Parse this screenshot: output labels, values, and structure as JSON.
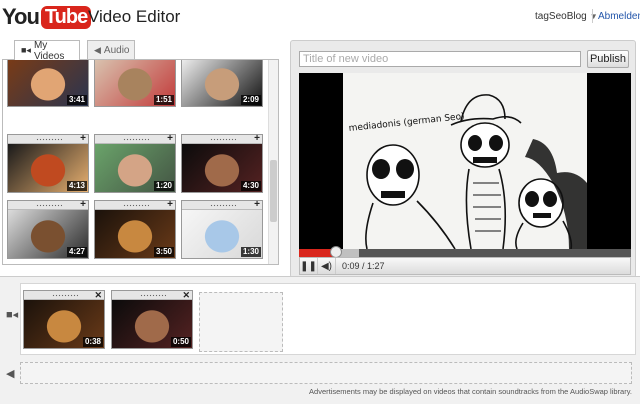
{
  "header": {
    "logo_you": "You",
    "logo_tube": "Tube",
    "title": "Video Editor",
    "username": "tagSeoBlog",
    "logout": "Abmelden"
  },
  "tabs": [
    {
      "label": "My Videos",
      "icon": "video-camera-icon",
      "active": true
    },
    {
      "label": "Audio",
      "icon": "speaker-icon",
      "active": false
    }
  ],
  "library": {
    "clips": [
      {
        "duration": "3:41",
        "colors": [
          "#7a3b16",
          "#e1a574",
          "#2a3550"
        ]
      },
      {
        "duration": "1:51",
        "colors": [
          "#d9c4b0",
          "#a8835e",
          "#c23a3a"
        ]
      },
      {
        "duration": "2:09",
        "colors": [
          "#f0f0f0",
          "#c79d7a",
          "#111111"
        ]
      },
      {
        "duration": "4:13",
        "colors": [
          "#1a1a1a",
          "#c04a20",
          "#e8b070"
        ]
      },
      {
        "duration": "1:20",
        "colors": [
          "#6aa36a",
          "#d4a486",
          "#445544"
        ]
      },
      {
        "duration": "4:30",
        "colors": [
          "#0b0b0b",
          "#a06a4a",
          "#552222"
        ]
      },
      {
        "duration": "4:27",
        "colors": [
          "#dcdcdc",
          "#7a5030",
          "#2a2a2a"
        ]
      },
      {
        "duration": "3:50",
        "colors": [
          "#1b120b",
          "#c88840",
          "#6a3a18"
        ]
      },
      {
        "duration": "1:30",
        "colors": [
          "#f6f6f6",
          "#a8c8e8",
          "#d8d8d8"
        ]
      }
    ]
  },
  "player": {
    "title_placeholder": "Title of new video",
    "publish_label": "Publish",
    "time": "0:09 / 1:27",
    "progress": 0.11,
    "loaded": 0.18,
    "video_caption": "mediadonis (german Seo)"
  },
  "timeline": {
    "clips": [
      {
        "duration": "0:38",
        "colors": [
          "#1b120b",
          "#c88840",
          "#6a3a18"
        ]
      },
      {
        "duration": "0:50",
        "colors": [
          "#0b0b0b",
          "#a06a4a",
          "#552222"
        ]
      }
    ],
    "ad_note": "Advertisements may be displayed on videos that contain soundtracks from the AudioSwap library."
  }
}
